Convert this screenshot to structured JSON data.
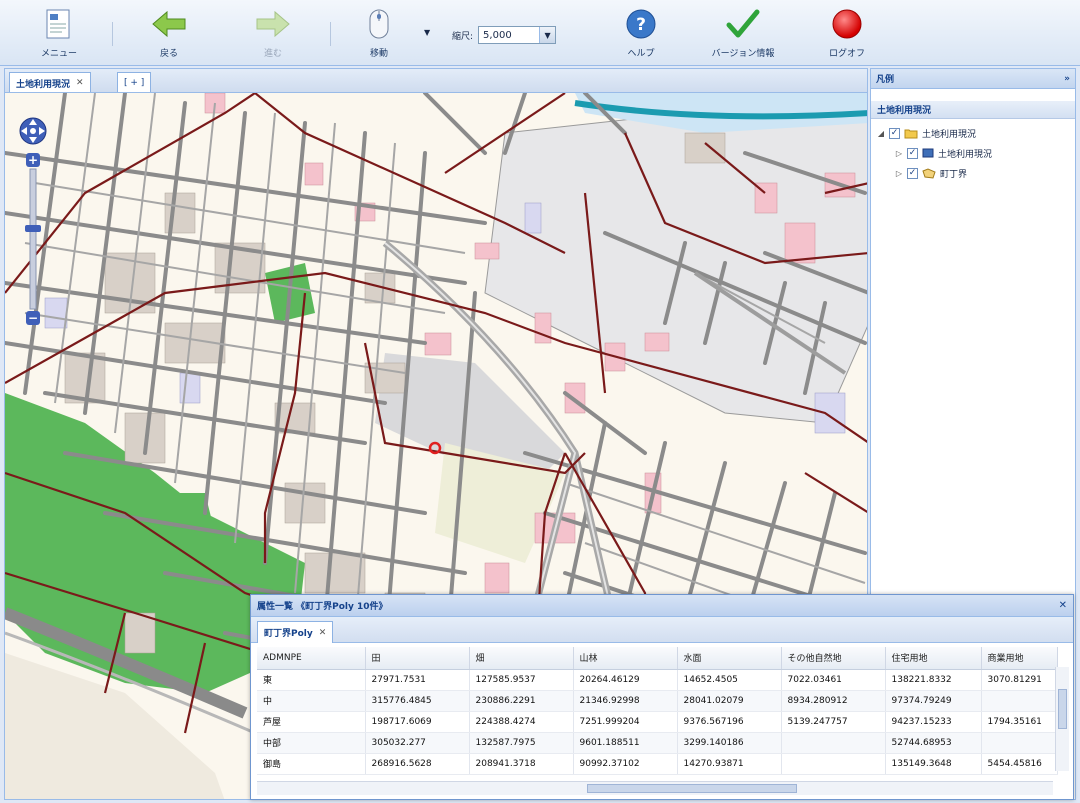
{
  "toolbar": {
    "menu_label": "メニュー",
    "back_label": "戻る",
    "forward_label": "進む",
    "mouse_label": "移動",
    "scale_label": "縮尺:",
    "scale_value": "5,000",
    "help_label": "ヘルプ",
    "version_label": "バージョン情報",
    "logoff_label": "ログオフ"
  },
  "tabs": {
    "map_tab": "土地利用現況",
    "add_tab": "[ + ]"
  },
  "legend": {
    "title": "凡例",
    "section": "土地利用現況",
    "tree": [
      {
        "label": "土地利用現況",
        "checked": "✓",
        "expander": "◢"
      },
      {
        "label": "土地利用現況",
        "checked": "✓",
        "expander": "▷"
      },
      {
        "label": "町丁界",
        "checked": "✓",
        "expander": "▷"
      }
    ]
  },
  "attribute": {
    "title": "属性一覧 《町丁界Poly 10件》",
    "tab": "町丁界Poly",
    "columns": [
      "ADMNPE",
      "田",
      "畑",
      "山林",
      "水面",
      "その他自然地",
      "住宅用地",
      "商業用地"
    ],
    "rows": [
      [
        "東",
        "27971.7531",
        "127585.9537",
        "20264.46129",
        "14652.4505",
        "7022.03461",
        "138221.8332",
        "3070.81291"
      ],
      [
        "中",
        "315776.4845",
        "230886.2291",
        "21346.92998",
        "28041.02079",
        "8934.280912",
        "97374.79249",
        ""
      ],
      [
        "芦屋",
        "198717.6069",
        "224388.4274",
        "7251.999204",
        "9376.567196",
        "5139.247757",
        "94237.15233",
        "1794.35161"
      ],
      [
        "中部",
        "305032.277",
        "132587.7975",
        "9601.188511",
        "3299.140186",
        "",
        "52744.68953",
        ""
      ],
      [
        "御島",
        "268916.5628",
        "208941.3718",
        "90992.37102",
        "14270.93871",
        "",
        "135149.3648",
        "5454.45816"
      ]
    ]
  },
  "colors": {
    "accent": "#15428b",
    "park_green": "#5cb85c",
    "boundary": "#7a1a1a",
    "commercial_pink": "#f4c2cc",
    "residential": "#d8d0c8"
  }
}
